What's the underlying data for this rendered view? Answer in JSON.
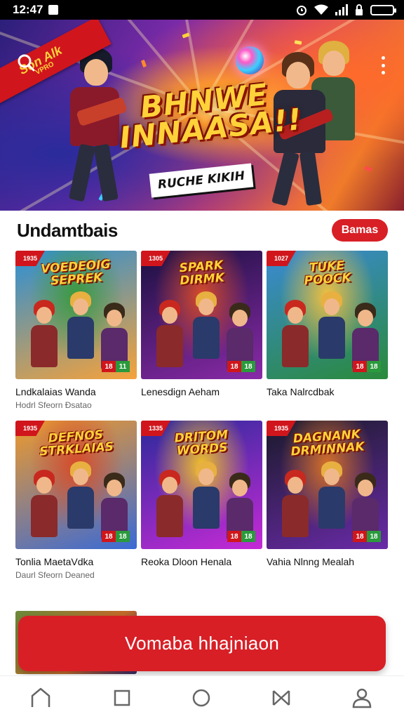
{
  "status_bar": {
    "time": "12:47",
    "icons": [
      "notification-icon",
      "alarm-icon",
      "wifi-icon",
      "signal-icon",
      "lock-icon",
      "battery-icon"
    ]
  },
  "hero": {
    "ribbon_line1": "Son Alk",
    "ribbon_line2": "VPRO",
    "title_line1": "BHNWE",
    "title_line2": "INNAASA!!",
    "subtitle": "RUCHE KIKIH",
    "icons": [
      "search-icon",
      "more-vert-icon"
    ]
  },
  "section": {
    "title": "Undamtbais",
    "chip_label": "Bamas"
  },
  "games": [
    {
      "art_title": "VOEDEOIG\nSEPREK",
      "tag": "1935",
      "name": "Lndkalaias Wanda",
      "meta": "Hodrl Sfeorn Ðsatao",
      "badge_left": "18",
      "badge_right": "11",
      "colors": [
        "#2a8fd6",
        "#f6a23a",
        "#3a9a3e"
      ]
    },
    {
      "art_title": "SPARK\nDIRMK",
      "tag": "1305",
      "name": "Lenesdign Aeham",
      "meta": "",
      "badge_left": "18",
      "badge_right": "18",
      "colors": [
        "#1a1040",
        "#8a2aa8",
        "#d64a2a"
      ]
    },
    {
      "art_title": "TUKE\nPOOCK",
      "tag": "1027",
      "name": "Taka Nalrcdbak",
      "meta": "",
      "badge_left": "18",
      "badge_right": "18",
      "colors": [
        "#3a8ad6",
        "#2a8a3a",
        "#f0c040"
      ]
    },
    {
      "art_title": "DEFNOS\nSTRKLAIAS",
      "tag": "1935",
      "name": "Tonlia MaetaVdka",
      "meta": "Daurl Sfeorn Deaned",
      "badge_left": "18",
      "badge_right": "18",
      "colors": [
        "#f09a2a",
        "#3a6ad6",
        "#d64a2a"
      ]
    },
    {
      "art_title": "DRITOM\nWORDS",
      "tag": "1335",
      "name": "Reoka Dloon Henala",
      "meta": "",
      "badge_left": "18",
      "badge_right": "18",
      "colors": [
        "#2a2a9a",
        "#c62ad6",
        "#f0c02a"
      ]
    },
    {
      "art_title": "DAGNANK\nDRMINNAK",
      "tag": "1935",
      "name": "Vahia Nlnng Mealah",
      "meta": "",
      "badge_left": "18",
      "badge_right": "18",
      "colors": [
        "#1a1a2a",
        "#6a2aa8",
        "#d6702a"
      ]
    }
  ],
  "cta": {
    "label": "Vomaba hhajniaon"
  },
  "nav": {
    "items": [
      "home-icon",
      "square-icon",
      "circle-icon",
      "bowtie-icon",
      "profile-icon"
    ]
  }
}
